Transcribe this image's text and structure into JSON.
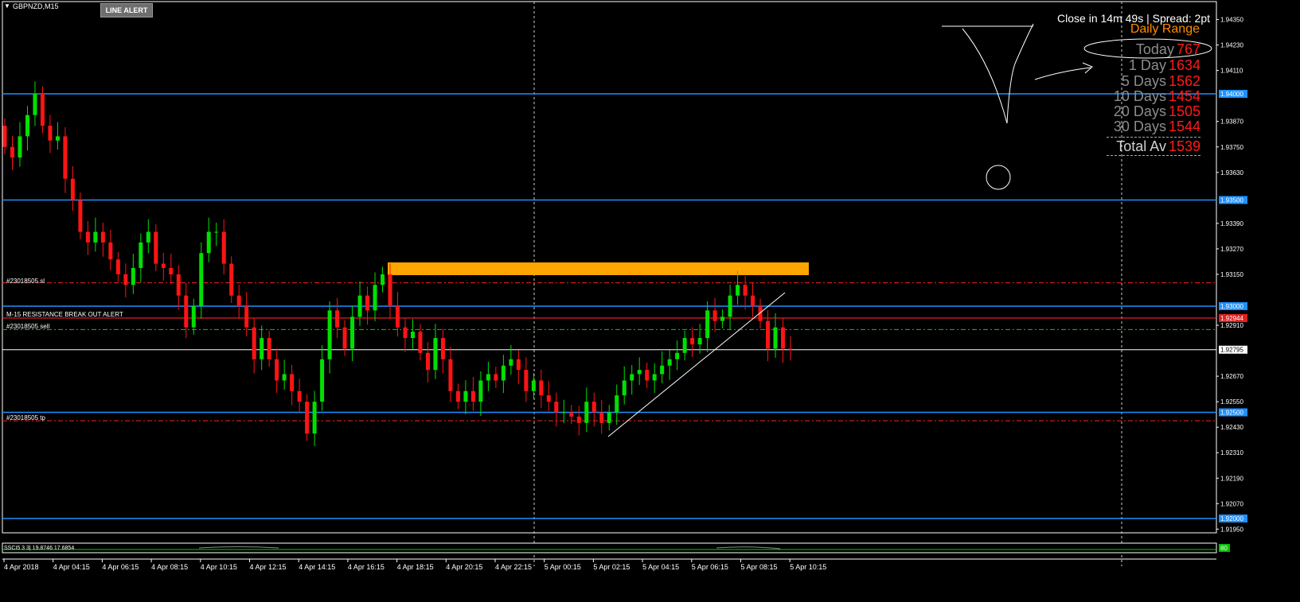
{
  "chart": {
    "symbol": "GBPNZD,M15",
    "line_alert_button": "LINE ALERT",
    "close_info": "Close in 14m 49s | Spread: 2pt",
    "indicator_label": "SSCI5 3 3| 19.8746 17.6854",
    "indicator_value": "80"
  },
  "daily_range": {
    "title": "Daily Range",
    "rows": [
      {
        "label": "Today",
        "value": "767"
      },
      {
        "label": "1 Day",
        "value": "1634"
      },
      {
        "label": "5 Days",
        "value": "1562"
      },
      {
        "label": "10 Days",
        "value": "1454"
      },
      {
        "label": "20 Days",
        "value": "1505"
      },
      {
        "label": "30 Days",
        "value": "1544"
      }
    ],
    "total": {
      "label": "Total Av",
      "value": "1539"
    }
  },
  "orders": {
    "sl": "#23018505 sl",
    "alert": "M-15 RESISTANCE BREAK OUT ALERT",
    "sell": "#23018505 sell",
    "tp": "#23018505 tp"
  },
  "price_axis": {
    "ticks": [
      "1.94350",
      "1.94230",
      "1.94110",
      "1.93870",
      "1.93750",
      "1.93630",
      "1.93390",
      "1.93270",
      "1.93150",
      "1.92910",
      "1.92670",
      "1.92550",
      "1.92430",
      "1.92310",
      "1.92190",
      "1.92070",
      "1.91950"
    ],
    "tags": [
      {
        "price": "1.94000",
        "color": "#1e90ff"
      },
      {
        "price": "1.93500",
        "color": "#1e90ff"
      },
      {
        "price": "1.93000",
        "color": "#1e90ff"
      },
      {
        "price": "1.92944",
        "color": "#e02020"
      },
      {
        "price": "1.92795",
        "color": "#ffffff"
      },
      {
        "price": "1.92500",
        "color": "#1e90ff"
      },
      {
        "price": "1.92000",
        "color": "#1e90ff"
      }
    ]
  },
  "time_axis": [
    "4 Apr 2018",
    "4 Apr 04:15",
    "4 Apr 06:15",
    "4 Apr 08:15",
    "4 Apr 10:15",
    "4 Apr 12:15",
    "4 Apr 14:15",
    "4 Apr 16:15",
    "4 Apr 18:15",
    "4 Apr 20:15",
    "4 Apr 22:15",
    "5 Apr 00:15",
    "5 Apr 02:15",
    "5 Apr 04:15",
    "5 Apr 06:15",
    "5 Apr 08:15",
    "5 Apr 10:15"
  ],
  "chart_data": {
    "type": "candlestick",
    "ylim": [
      1.9189,
      1.9445
    ],
    "colors": {
      "bull": "#00e000",
      "bear": "#ff1414",
      "background": "#000000"
    },
    "horizontal_levels": [
      1.94,
      1.935,
      1.93,
      1.925,
      1.92
    ],
    "bid": 1.92795,
    "alert_level": 1.92944,
    "sl_level": 1.9311,
    "sell_level": 1.9289,
    "tp_level": 1.9246,
    "closes": [
      1.9375,
      1.937,
      1.938,
      1.939,
      1.94,
      1.9385,
      1.9378,
      1.938,
      1.936,
      1.935,
      1.9335,
      1.933,
      1.9335,
      1.933,
      1.9322,
      1.9315,
      1.931,
      1.9318,
      1.933,
      1.9335,
      1.932,
      1.9318,
      1.9315,
      1.9305,
      1.929,
      1.93,
      1.9325,
      1.9335,
      1.9335,
      1.932,
      1.9305,
      1.93,
      1.929,
      1.9275,
      1.9285,
      1.9275,
      1.9265,
      1.9268,
      1.926,
      1.9255,
      1.924,
      1.9255,
      1.9275,
      1.9298,
      1.929,
      1.928,
      1.9295,
      1.9305,
      1.9298,
      1.931,
      1.9315,
      1.93,
      1.929,
      1.9285,
      1.9288,
      1.9278,
      1.927,
      1.9285,
      1.9275,
      1.926,
      1.9255,
      1.926,
      1.9255,
      1.9265,
      1.9268,
      1.9265,
      1.9272,
      1.9275,
      1.927,
      1.926,
      1.9265,
      1.9258,
      1.9255,
      1.925,
      1.925,
      1.9248,
      1.9245,
      1.9255,
      1.925,
      1.9245,
      1.925,
      1.9258,
      1.9265,
      1.9268,
      1.927,
      1.9265,
      1.9268,
      1.9272,
      1.9275,
      1.9278,
      1.9285,
      1.9282,
      1.9285,
      1.9298,
      1.9293,
      1.9295,
      1.9305,
      1.931,
      1.9305,
      1.93,
      1.9293,
      1.928,
      1.929,
      1.928,
      1.92795
    ]
  }
}
